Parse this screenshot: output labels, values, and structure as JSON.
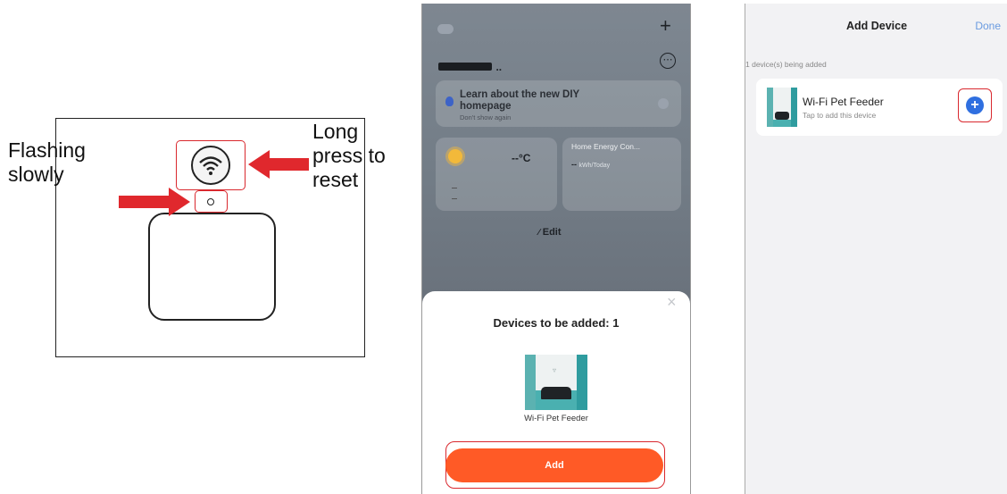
{
  "diagram": {
    "left_label_line1": "Flashing",
    "left_label_line2": "slowly",
    "right_label_line1": "Long",
    "right_label_line2": "press to",
    "right_label_line3": "reset"
  },
  "home_screen": {
    "tip_title_line1": "Learn about the new DIY",
    "tip_title_line2": "homepage",
    "tip_sub": "Don't show again",
    "weather_temp": "--°C",
    "energy_title": "Home Energy Con...",
    "energy_value": "--",
    "energy_unit": "kWh/Today",
    "edit_label": "Edit",
    "plus_glyph": "+",
    "more_glyph": "⋯",
    "home_name_suffix": ".."
  },
  "add_sheet": {
    "title": "Devices to be added: 1",
    "device_name": "Wi-Fi Pet Feeder",
    "add_button": "Add",
    "close_glyph": "×"
  },
  "add_device_screen": {
    "title": "Add Device",
    "done": "Done",
    "status": "1 device(s) being added",
    "device_name": "Wi-Fi Pet Feeder",
    "device_hint": "Tap to add this device",
    "plus_glyph": "+"
  },
  "colors": {
    "accent_orange": "#ff5a26",
    "callout_red": "#d9282e",
    "plus_blue": "#2f6fe0",
    "done_blue": "#6a9be0"
  }
}
